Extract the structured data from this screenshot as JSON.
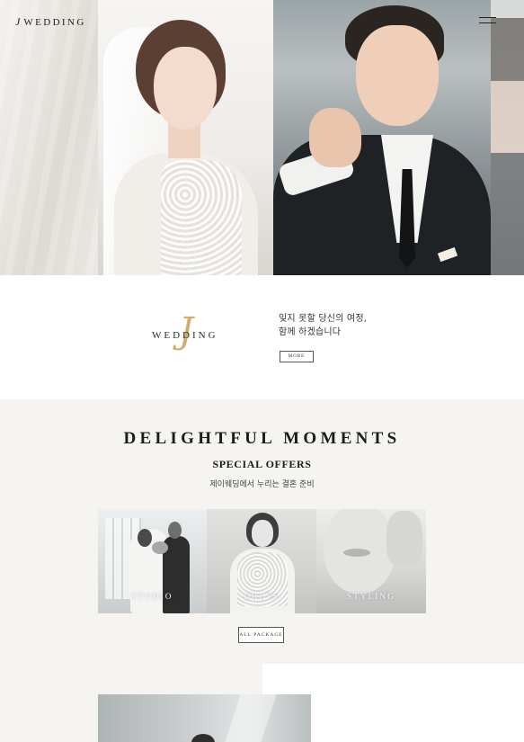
{
  "header": {
    "logo_j": "J",
    "logo_text": "WEDDING",
    "menu_icon": "hamburger-menu-icon"
  },
  "hero": {
    "panels": [
      "veil-detail",
      "bride-portrait",
      "groom-portrait",
      "side-crop"
    ]
  },
  "intro": {
    "brand_j": "J",
    "brand_word": "WEDDING",
    "brand_accent_color": "#d0ad6c",
    "tagline": [
      "잊지 못할 당신의 여정,",
      "함께 하겠습니다"
    ],
    "more_label": "MORE"
  },
  "offers": {
    "title": "DELIGHTFUL MOMENTS",
    "subtitle": "SPECIAL OFFERS",
    "description": "제이웨딩에서 누리는 결혼 준비",
    "cards": [
      {
        "label": "STUDIO"
      },
      {
        "label": "DRESS"
      },
      {
        "label": "STYLING"
      }
    ],
    "all_package_label": "ALL PACKAGE",
    "background_color": "#f5f4f0"
  }
}
